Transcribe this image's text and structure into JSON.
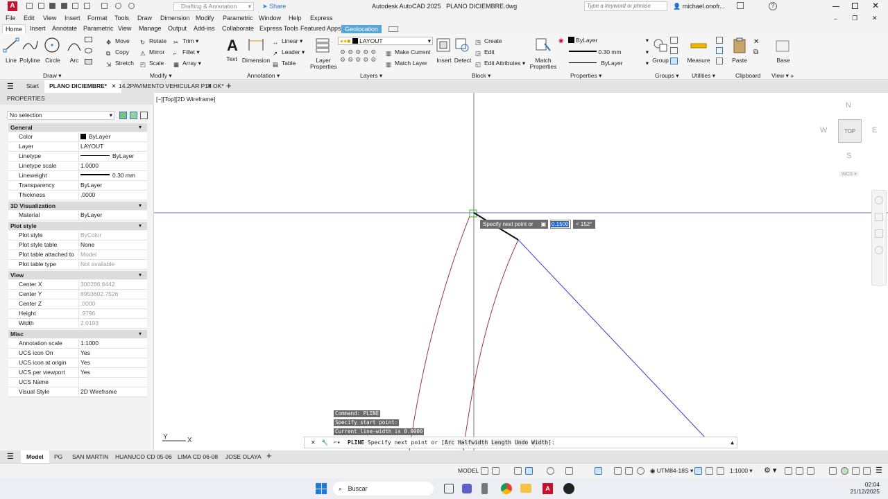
{
  "titlebar": {
    "quick_access": "Drafting & Annotation",
    "share": "Share",
    "app_title": "Autodesk AutoCAD 2025",
    "file_title": "PLANO DICIEMBRE.dwg",
    "search_placeholder": "Type a keyword or phrase",
    "user": "michael.onofr..."
  },
  "menu": [
    "File",
    "Edit",
    "View",
    "Insert",
    "Format",
    "Tools",
    "Draw",
    "Dimension",
    "Modify",
    "Parametric",
    "Window",
    "Help",
    "Express"
  ],
  "ribbon_tabs": [
    "Home",
    "Insert",
    "Annotate",
    "Parametric",
    "View",
    "Manage",
    "Output",
    "Add-ins",
    "Collaborate",
    "Express Tools",
    "Featured Apps",
    "Geolocation"
  ],
  "draw": {
    "line": "Line",
    "polyline": "Polyline",
    "circle": "Circle",
    "arc": "Arc",
    "label": "Draw"
  },
  "modify": {
    "move": "Move",
    "rotate": "Rotate",
    "trim": "Trim",
    "copy": "Copy",
    "mirror": "Mirror",
    "fillet": "Fillet",
    "stretch": "Stretch",
    "scale": "Scale",
    "array": "Array",
    "label": "Modify"
  },
  "annotation": {
    "text": "Text",
    "dimension": "Dimension",
    "linear": "Linear",
    "leader": "Leader",
    "table": "Table",
    "label": "Annotation"
  },
  "layers": {
    "layer_properties": "Layer Properties",
    "current_layer": "LAYOUT",
    "make_current": "Make Current",
    "match_layer": "Match Layer",
    "label": "Layers"
  },
  "block": {
    "insert": "Insert",
    "detect": "Detect",
    "create": "Create",
    "edit": "Edit",
    "edit_attributes": "Edit Attributes",
    "label": "Block"
  },
  "properties_panel": {
    "match": "Match Properties",
    "color": "ByLayer",
    "lineweight": "0.30 mm",
    "linetype": "ByLayer",
    "label": "Properties"
  },
  "groups": {
    "group": "Group",
    "label": "Groups"
  },
  "utilities": {
    "measure": "Measure",
    "label": "Utilities"
  },
  "clipboard": {
    "paste": "Paste",
    "label": "Clipboard"
  },
  "view_panel": {
    "base": "Base",
    "label": "View"
  },
  "file_tabs": [
    "Start",
    "PLANO DICIEMBRE*",
    "14.2PAVIMENTO VEHICULAR P18 OK*"
  ],
  "properties": {
    "title": "PROPERTIES",
    "selection": "No selection",
    "sections": [
      {
        "name": "General",
        "rows": [
          [
            "Color",
            "ByLayer"
          ],
          [
            "Layer",
            "LAYOUT"
          ],
          [
            "Linetype",
            "ByLayer"
          ],
          [
            "Linetype scale",
            "1.0000"
          ],
          [
            "Lineweight",
            "0.30 mm"
          ],
          [
            "Transparency",
            "ByLayer"
          ],
          [
            "Thickness",
            ".0000"
          ]
        ]
      },
      {
        "name": "3D Visualization",
        "rows": [
          [
            "Material",
            "ByLayer"
          ]
        ]
      },
      {
        "name": "Plot style",
        "rows": [
          [
            "Plot style",
            "ByColor"
          ],
          [
            "Plot style table",
            "None"
          ],
          [
            "Plot table attached to",
            "Model"
          ],
          [
            "Plot table type",
            "Not available"
          ]
        ]
      },
      {
        "name": "View",
        "rows": [
          [
            "Center X",
            "300286.6442"
          ],
          [
            "Center Y",
            "8953602.7526"
          ],
          [
            "Center Z",
            ".0000"
          ],
          [
            "Height",
            ".9796"
          ],
          [
            "Width",
            "2.0193"
          ]
        ]
      },
      {
        "name": "Misc",
        "rows": [
          [
            "Annotation scale",
            "1:1000"
          ],
          [
            "UCS icon On",
            "Yes"
          ],
          [
            "UCS icon at origin",
            "Yes"
          ],
          [
            "UCS per viewport",
            "Yes"
          ],
          [
            "UCS Name",
            ""
          ],
          [
            "Visual Style",
            "2D Wireframe"
          ]
        ]
      }
    ]
  },
  "viewport": {
    "label": "[−][Top][2D Wireframe]",
    "viewcube": {
      "n": "N",
      "s": "S",
      "e": "E",
      "w": "W",
      "top": "TOP",
      "wcs": "WCS"
    },
    "tooltip": "Specify next point or",
    "input_value": "0.1500",
    "angle": "< 152°"
  },
  "command_history": [
    "Command:  PLINE",
    "Specify start point:",
    "Current line-width is 0.0000"
  ],
  "command_line": {
    "prefix": "PLINE",
    "text": "Specify next point or [",
    "opts": [
      "Arc",
      "Halfwidth",
      "Length",
      "Undo",
      "Width"
    ],
    "suffix": "]:"
  },
  "layout_tabs": [
    "Model",
    "PG",
    "SAN MARTIN",
    "HUANUCO CD 05-06",
    "LIMA CD 06-08",
    "JOSE OLAYA"
  ],
  "status": {
    "model": "MODEL",
    "coord": "UTM84-18S",
    "scale": "1:1000"
  },
  "taskbar": {
    "search": "Buscar",
    "time": "02:04",
    "date": "21/12/2025"
  }
}
